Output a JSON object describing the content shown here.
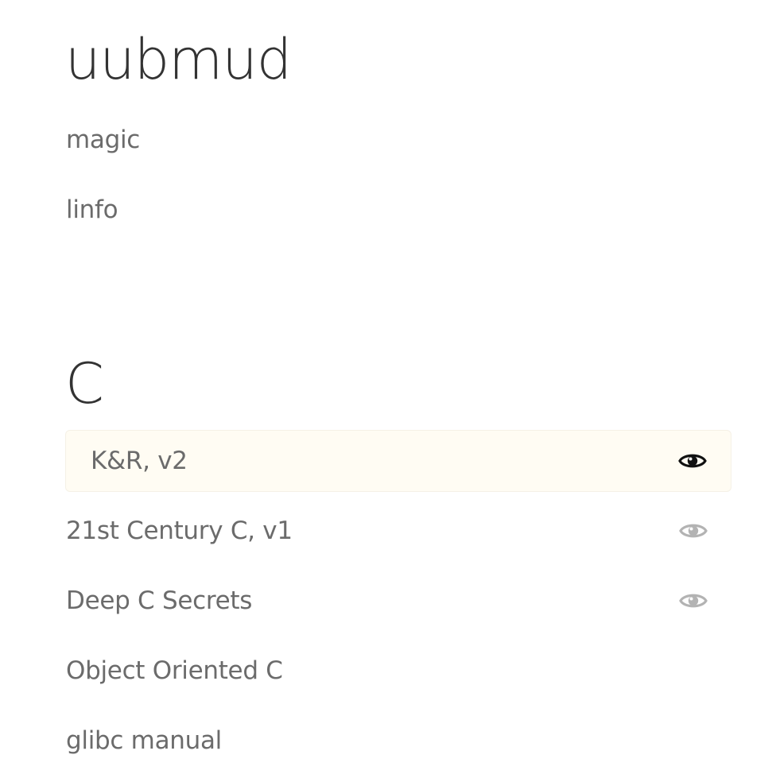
{
  "sections": [
    {
      "title": "uubmud",
      "items": [
        {
          "label": "magic"
        },
        {
          "label": "linfo"
        }
      ]
    },
    {
      "title": "C",
      "items": [
        {
          "label": "K&R, v2",
          "highlighted": true,
          "eye_icon": "eye-icon",
          "eye_color": "#111111"
        },
        {
          "label": "21st Century C, v1",
          "eye_icon": "eye-icon",
          "eye_color": "#b3b3b3"
        },
        {
          "label": "Deep C Secrets",
          "eye_icon": "eye-icon",
          "eye_color": "#b3b3b3"
        },
        {
          "label": "Object Oriented C"
        },
        {
          "label": "glibc manual"
        }
      ]
    }
  ],
  "colors": {
    "heading": "#333333",
    "item_text": "#6b6b6b",
    "highlight_bg": "#fffcf3"
  }
}
